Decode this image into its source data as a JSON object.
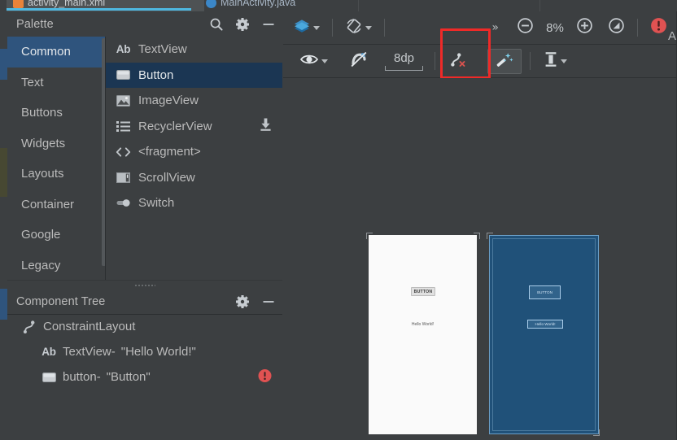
{
  "editor_tabs": [
    {
      "label": "activity_main.xml",
      "icon": "xml-file-icon",
      "active": true
    },
    {
      "label": "MainActivity.java",
      "icon": "java-file-icon",
      "active": false
    }
  ],
  "palette": {
    "title": "Palette",
    "actions": [
      {
        "name": "search-icon",
        "label": "Search"
      },
      {
        "name": "gear-icon",
        "label": "Palette settings"
      },
      {
        "name": "minimize-icon",
        "label": "Hide"
      }
    ],
    "categories": [
      {
        "label": "Common",
        "selected": true
      },
      {
        "label": "Text",
        "selected": false
      },
      {
        "label": "Buttons",
        "selected": false
      },
      {
        "label": "Widgets",
        "selected": false
      },
      {
        "label": "Layouts",
        "selected": false
      },
      {
        "label": "Container",
        "selected": false
      },
      {
        "label": "Google",
        "selected": false
      },
      {
        "label": "Legacy",
        "selected": false
      }
    ],
    "items": [
      {
        "label": "TextView",
        "icon": "ab-text-icon",
        "selected": false,
        "download": false
      },
      {
        "label": "Button",
        "icon": "button-icon",
        "selected": true,
        "download": false
      },
      {
        "label": "ImageView",
        "icon": "image-icon",
        "selected": false,
        "download": false
      },
      {
        "label": "RecyclerView",
        "icon": "list-icon",
        "selected": false,
        "download": true
      },
      {
        "label": "<fragment>",
        "icon": "code-brackets-icon",
        "selected": false,
        "download": false
      },
      {
        "label": "ScrollView",
        "icon": "scrollview-icon",
        "selected": false,
        "download": false
      },
      {
        "label": "Switch",
        "icon": "switch-icon",
        "selected": false,
        "download": false
      }
    ]
  },
  "component_tree": {
    "title": "Component Tree",
    "actions": [
      {
        "name": "gear-icon",
        "label": "Tree settings"
      },
      {
        "name": "minimize-icon",
        "label": "Hide"
      }
    ],
    "nodes": [
      {
        "icon": "constraint-layout-icon",
        "name": "ConstraintLayout",
        "value": "",
        "depth": 0,
        "error": false
      },
      {
        "icon": "ab-text-icon",
        "name": "TextView-",
        "value": "\"Hello World!\"",
        "depth": 1,
        "error": false
      },
      {
        "icon": "button-icon",
        "name": "button-",
        "value": "\"Button\"",
        "depth": 1,
        "error": true
      }
    ]
  },
  "design_toolbar": {
    "row1": [
      {
        "name": "design-mode-button",
        "icon": "layers-icon",
        "label": "",
        "dropdown": true
      },
      {
        "name": "orientation-button",
        "icon": "rotate-device-icon",
        "label": "",
        "dropdown": true
      },
      {
        "name": "overflow-button",
        "icon": "double-chevron-icon",
        "label": "»",
        "dropdown": false
      },
      {
        "name": "zoom-out-button",
        "icon": "minus-circle-icon",
        "label": "",
        "dropdown": false
      },
      {
        "name": "zoom-level",
        "icon": "",
        "label": "8%",
        "dropdown": false
      },
      {
        "name": "zoom-in-button",
        "icon": "plus-circle-icon",
        "label": "",
        "dropdown": false
      },
      {
        "name": "zoom-to-fit-button",
        "icon": "fit-screen-icon",
        "label": "",
        "dropdown": false
      },
      {
        "name": "error-indicator",
        "icon": "error-circle-icon",
        "label": "",
        "dropdown": false
      }
    ],
    "row2": [
      {
        "name": "show-constraints-button",
        "icon": "eye-icon",
        "label": "",
        "dropdown": true
      },
      {
        "name": "autoconnect-button",
        "icon": "magnet-off-icon",
        "label": "",
        "dropdown": false
      },
      {
        "name": "default-margin-button",
        "icon": "margin-ruler-icon",
        "label": "8dp",
        "dropdown": false
      },
      {
        "name": "clear-constraints-button",
        "icon": "clear-constraints-icon",
        "label": "",
        "dropdown": false
      },
      {
        "name": "infer-constraints-button",
        "icon": "magic-wand-icon",
        "label": "",
        "dropdown": false,
        "highlighted": true
      },
      {
        "name": "vertical-align-button",
        "icon": "align-vertical-icon",
        "label": "",
        "dropdown": true
      }
    ],
    "right_edge_label": "A"
  },
  "canvas": {
    "design_view": {
      "name": "design-preview",
      "button_label": "BUTTON",
      "text_label": "Hello World!"
    },
    "blueprint_view": {
      "name": "blueprint-preview",
      "button_label": "BUTTON",
      "text_label": "Hello World!"
    }
  },
  "colors": {
    "panel_bg": "#3c3f41",
    "selection_blue": "#2f547d",
    "item_selection_blue": "#1b3653",
    "tab_underline": "#4eb8e0",
    "highlight_red": "#ef2a28",
    "error_red": "#e05252",
    "blueprint_blue": "#205179",
    "design_white": "#fafafa"
  }
}
